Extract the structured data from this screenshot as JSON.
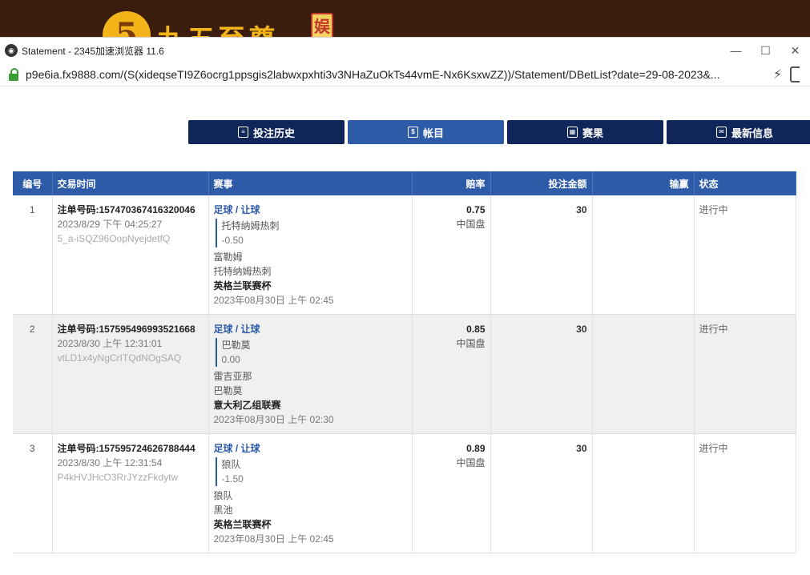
{
  "background_banner": {
    "logo_digit": "5",
    "logo_text": "九五至尊",
    "logo_tag": "娱"
  },
  "window": {
    "title": "Statement - 2345加速浏览器 11.6",
    "app_icon": "2345",
    "controls": {
      "minimize": "—",
      "maximize": "☐",
      "close": "✕"
    },
    "url": "p9e6ia.fx9888.com/(S(xideqseTI9Z6ocrg1ppsgis2labwxpxhti3v3NHaZuOkTs44vmE-Nx6KsxwZZ))/Statement/DBetList?date=29-08-2023&..."
  },
  "nav": {
    "tabs": [
      {
        "label": "投注历史",
        "icon": "history-icon",
        "active": false
      },
      {
        "label": "帐目",
        "icon": "ledger-icon",
        "active": true
      },
      {
        "label": "赛果",
        "icon": "results-icon",
        "active": false
      },
      {
        "label": "最新信息",
        "icon": "mail-icon",
        "active": false
      }
    ]
  },
  "table": {
    "headers": {
      "no": "编号",
      "time": "交易时间",
      "event": "赛事",
      "odds": "赔率",
      "stake": "投注金额",
      "winloss": "输赢",
      "status": "状态"
    },
    "rows": [
      {
        "no": "1",
        "ticket": "注单号码:157470367416320046",
        "time": "2023/8/29 下午 04:25:27",
        "code": "5_a-iSQZ96OopNyejdetfQ",
        "sport": "足球 / 让球",
        "selection": "托特纳姆热刺",
        "handicap": "-0.50",
        "home": "富勒姆",
        "away": "托特纳姆热刺",
        "league": "英格兰联赛杯",
        "match_time": "2023年08月30日 上午 02:45",
        "odds": "0.75",
        "odds_type": "中国盘",
        "stake": "30",
        "winloss": "",
        "status": "进行中"
      },
      {
        "no": "2",
        "ticket": "注单号码:157595496993521668",
        "time": "2023/8/30 上午 12:31:01",
        "code": "vtLD1x4yNgCrITQdNOgSAQ",
        "sport": "足球 / 让球",
        "selection": "巴勒莫",
        "handicap": "0.00",
        "home": "雷吉亚那",
        "away": "巴勒莫",
        "league": "意大利乙组联赛",
        "match_time": "2023年08月30日 上午 02:30",
        "odds": "0.85",
        "odds_type": "中国盘",
        "stake": "30",
        "winloss": "",
        "status": "进行中"
      },
      {
        "no": "3",
        "ticket": "注单号码:157595724626788444",
        "time": "2023/8/30 上午 12:31:54",
        "code": "P4kHVJHcO3RrJYzzFkdytw",
        "sport": "足球 / 让球",
        "selection": "狼队",
        "handicap": "-1.50",
        "home": "狼队",
        "away": "黑池",
        "league": "英格兰联赛杯",
        "match_time": "2023年08月30日 上午 02:45",
        "odds": "0.89",
        "odds_type": "中国盘",
        "stake": "30",
        "winloss": "",
        "status": "进行中"
      }
    ]
  },
  "colors": {
    "header_blue": "#2d5ba8",
    "tab_navy": "#10265a",
    "accent": "#2d5ba8"
  }
}
